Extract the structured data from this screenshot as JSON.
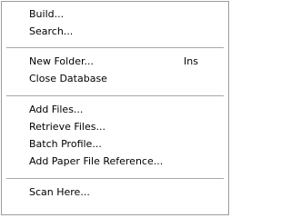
{
  "menu": {
    "groups": [
      {
        "items": [
          {
            "label": "Build..."
          },
          {
            "label": "Search..."
          }
        ]
      },
      {
        "items": [
          {
            "label": "New Folder...",
            "shortcut": "Ins"
          },
          {
            "label": "Close Database"
          }
        ]
      },
      {
        "items": [
          {
            "label": "Add Files..."
          },
          {
            "label": "Retrieve Files..."
          },
          {
            "label": "Batch Profile..."
          },
          {
            "label": "Add Paper File Reference..."
          }
        ]
      },
      {
        "items": [
          {
            "label": "Scan Here..."
          }
        ]
      }
    ]
  }
}
